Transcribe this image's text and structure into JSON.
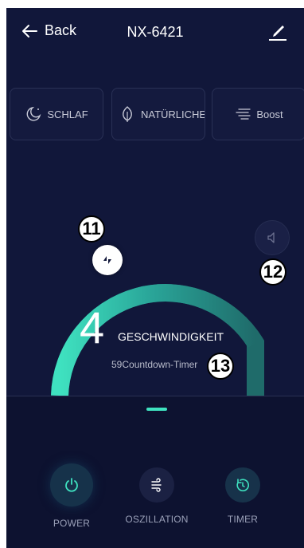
{
  "header": {
    "back_label": "Back",
    "title": "NX-6421"
  },
  "modes": [
    {
      "label": "SCHLAF",
      "icon": "moon-icon"
    },
    {
      "label": "NATÜRLICHER",
      "icon": "leaf-icon"
    },
    {
      "label": "Boost",
      "icon": "wind-lines-icon"
    }
  ],
  "speed": {
    "value": "4",
    "label": "GESCHWINDIGKEIT",
    "countdown": "59Countdown-Timer",
    "level_fraction": 0.22
  },
  "annotations": {
    "a11": "11",
    "a12": "12",
    "a13": "13"
  },
  "controls": {
    "power": "POWER",
    "oscillation": "OSZILLATION",
    "timer": "TIMER"
  },
  "colors": {
    "background": "#11173a",
    "accent": "#3fe2c0",
    "track": "#1f6b6a"
  }
}
